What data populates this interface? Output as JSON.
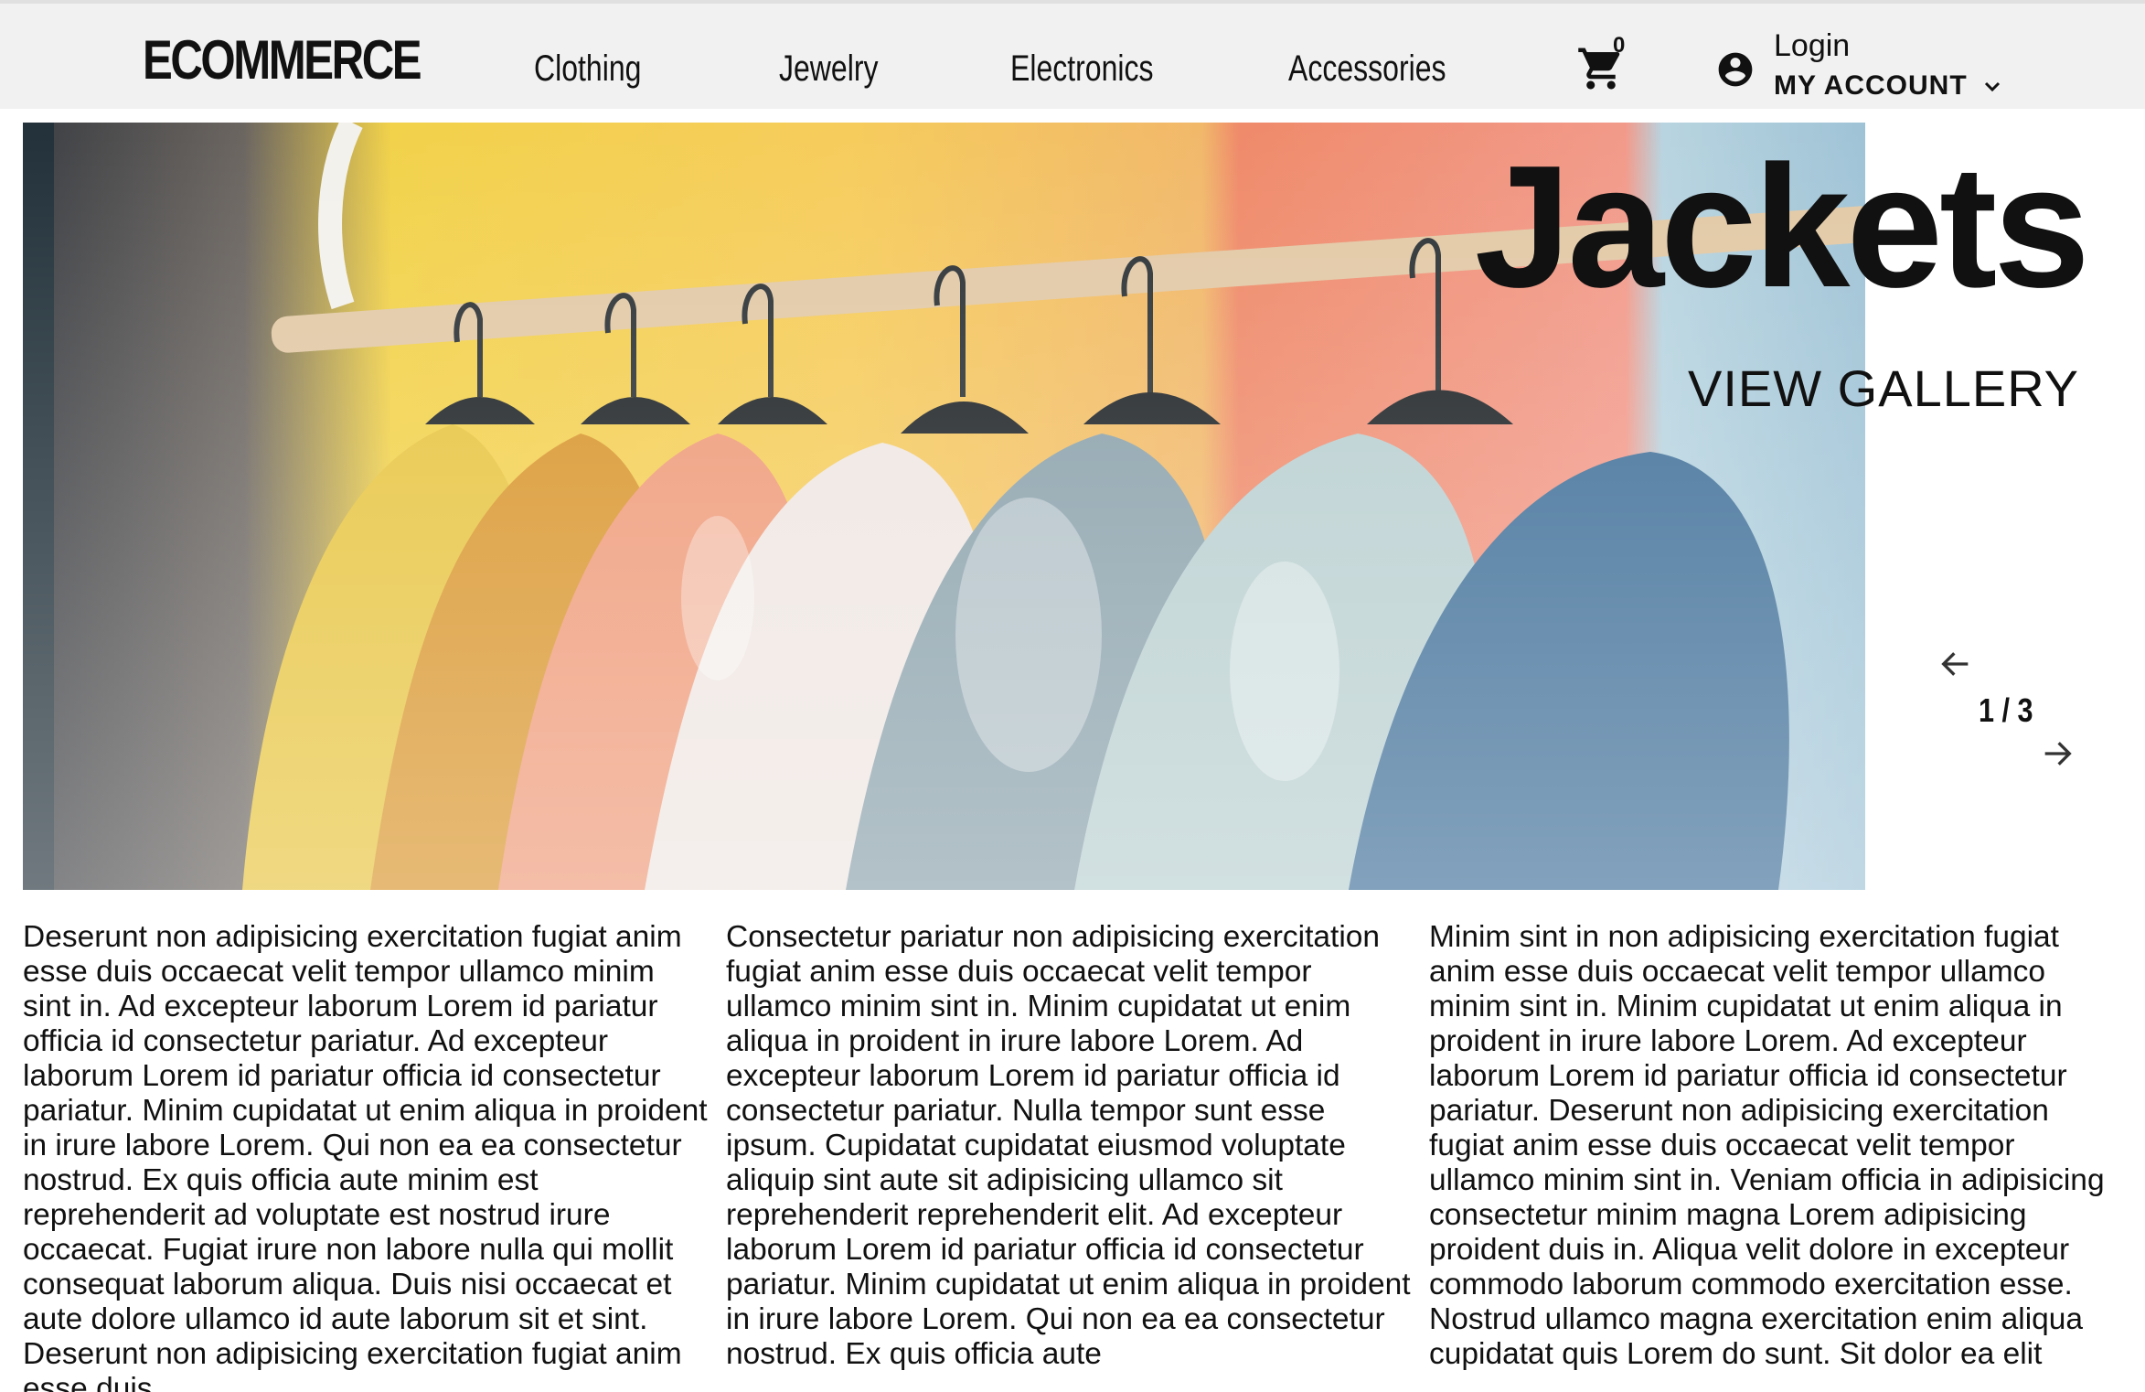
{
  "header": {
    "logo": "ECOMMERCE",
    "nav": [
      "Clothing",
      "Jewelry",
      "Electronics",
      "Accessories"
    ],
    "cart_count": "0",
    "login_label": "Login",
    "account_label": "MY ACCOUNT"
  },
  "hero": {
    "title": "Jackets",
    "cta": "VIEW GALLERY",
    "pager": "1 / 3"
  },
  "columns": [
    "Deserunt non adipisicing exercitation fugiat anim esse duis occaecat velit tempor ullamco minim sint in. Ad excepteur laborum Lorem id pariatur officia id consectetur pariatur. Ad excepteur laborum Lorem id pariatur officia id consectetur pariatur. Minim cupidatat ut enim aliqua in proident in irure labore Lorem. Qui non ea ea consectetur nostrud. Ex quis officia aute minim est reprehenderit ad voluptate est nostrud irure occaecat. Fugiat irure non labore nulla qui mollit consequat laborum aliqua. Duis nisi occaecat et aute dolore ullamco id aute laborum sit et sint. Deserunt non adipisicing exercitation fugiat anim esse duis",
    "Consectetur pariatur non adipisicing exercitation fugiat anim esse duis occaecat velit tempor ullamco minim sint in. Minim cupidatat ut enim aliqua in proident in irure labore Lorem. Ad excepteur laborum Lorem id pariatur officia id consectetur pariatur. Nulla tempor sunt esse ipsum. Cupidatat cupidatat eiusmod voluptate aliquip sint aute sit adipisicing ullamco sit reprehenderit reprehenderit elit. Ad excepteur laborum Lorem id pariatur officia id consectetur pariatur. Minim cupidatat ut enim aliqua in proident in irure labore Lorem. Qui non ea ea consectetur nostrud. Ex quis officia aute",
    "Minim sint in non adipisicing exercitation fugiat anim esse duis occaecat velit tempor ullamco minim sint in. Minim cupidatat ut enim aliqua in proident in irure labore Lorem. Ad excepteur laborum Lorem id pariatur officia id consectetur pariatur. Deserunt non adipisicing exercitation fugiat anim esse duis occaecat velit tempor ullamco minim sint in. Veniam officia in adipisicing consectetur minim magna Lorem adipisicing proident duis in. Aliqua velit dolore in excepteur commodo laborum commodo exercitation esse. Nostrud ullamco magna exercitation enim aliqua cupidatat quis Lorem do sunt. Sit dolor ea elit"
  ],
  "colors": {
    "header_bg": "#f1f1f1",
    "text": "#111111"
  },
  "icons": [
    "cart-icon",
    "account-circle-icon",
    "chevron-down-icon",
    "arrow-left-icon",
    "arrow-right-icon"
  ]
}
